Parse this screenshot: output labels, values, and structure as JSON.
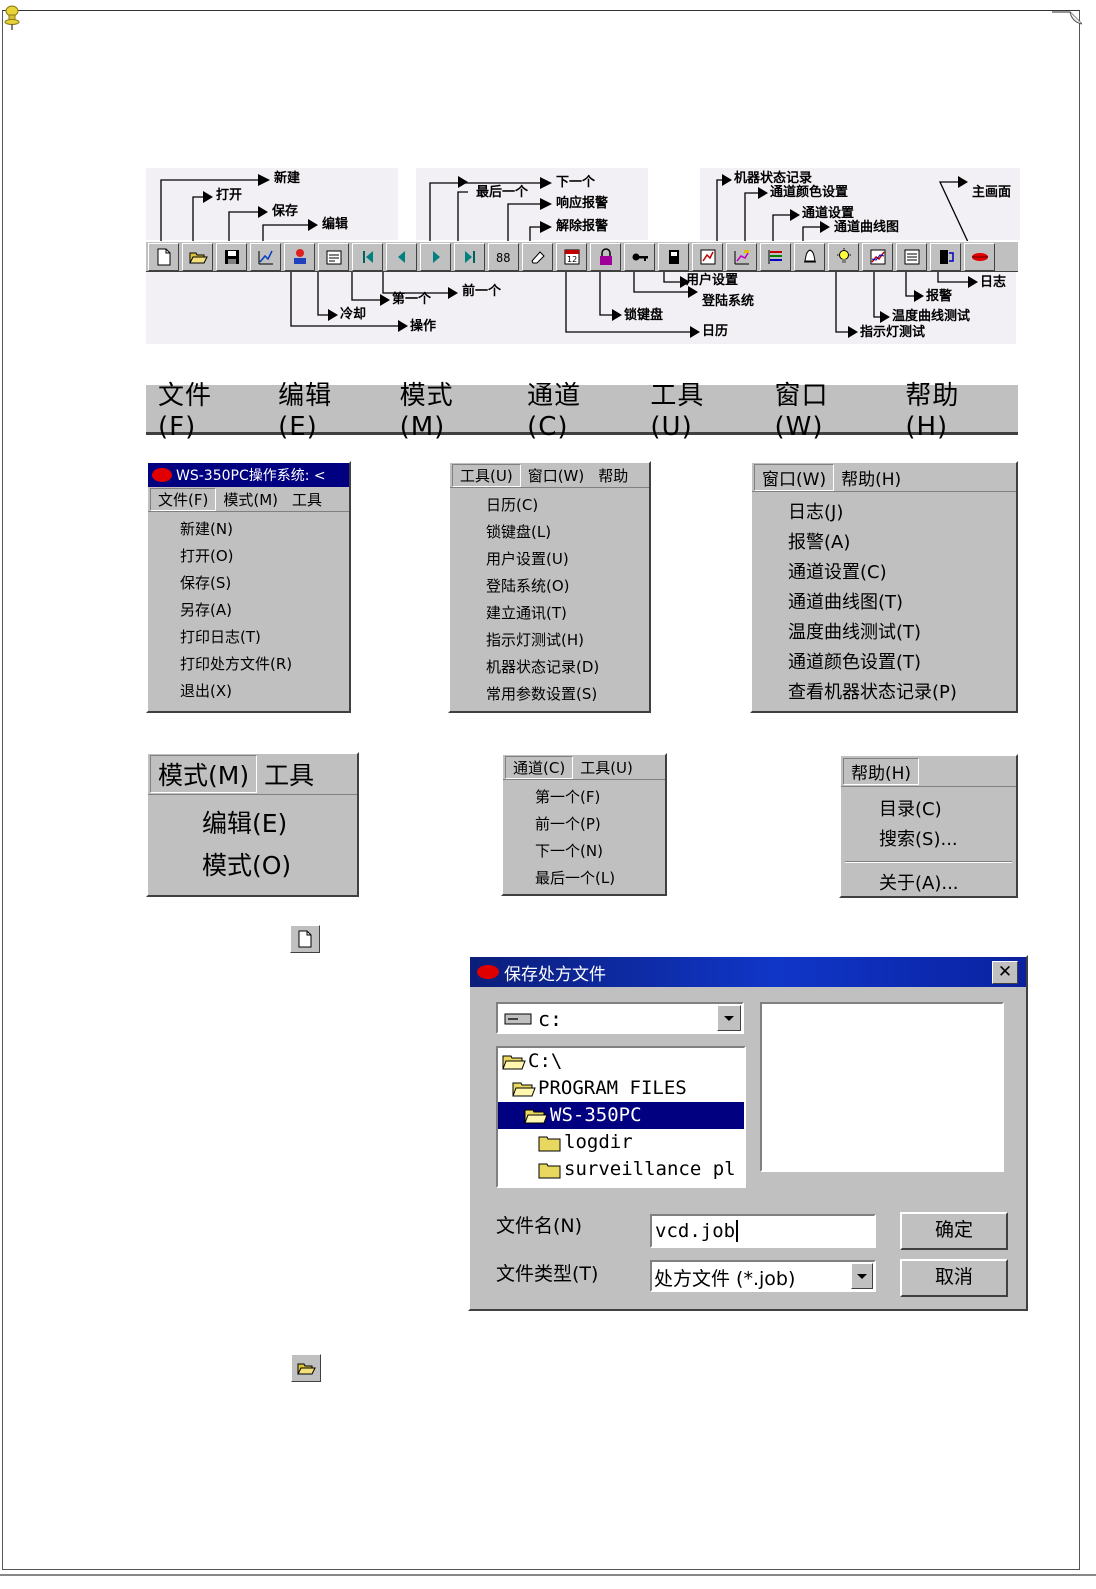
{
  "toolbar_labels": {
    "new": "新建",
    "open": "打开",
    "save": "保存",
    "edit": "编辑",
    "last": "最后一个",
    "next": "下一个",
    "ack_alarm": "响应报警",
    "clear_alarm": "解除报警",
    "machine_log": "机器状态记录",
    "channel_color": "通道颜色设置",
    "channel_setup": "通道设置",
    "channel_curve": "通道曲线图",
    "main": "主画面",
    "cool": "冷却",
    "first": "第一个",
    "prev": "前一个",
    "operate": "操作",
    "user_setup": "用户设置",
    "login": "登陆系统",
    "keylock": "锁键盘",
    "calendar": "日历",
    "log": "日志",
    "alarm": "报警",
    "temp_curve": "温度曲线测试",
    "lamp_test": "指示灯测试"
  },
  "menubar": [
    "文件(F)",
    "编辑(E)",
    "模式(M)",
    "通道(C)",
    "工具(U)",
    "窗口(W)",
    "帮助(H)"
  ],
  "file_menu": {
    "title": "WS-350PC操作系统: <",
    "bar": [
      "文件(F)",
      "模式(M)",
      "工具"
    ],
    "items": [
      "新建(N)",
      "打开(O)",
      "保存(S)",
      "另存(A)",
      "打印日志(T)",
      "打印处方文件(R)",
      "退出(X)"
    ]
  },
  "tools_menu": {
    "bar": [
      "工具(U)",
      "窗口(W)",
      "帮助"
    ],
    "items": [
      "日历(C)",
      "锁键盘(L)",
      "用户设置(U)",
      "登陆系统(O)",
      "建立通讯(T)",
      "指示灯测试(H)",
      "机器状态记录(D)",
      "常用参数设置(S)"
    ]
  },
  "window_menu": {
    "bar": [
      "窗口(W)",
      "帮助(H)"
    ],
    "items": [
      "日志(J)",
      "报警(A)",
      "通道设置(C)",
      "通道曲线图(T)",
      "温度曲线测试(T)",
      "通道颜色设置(T)",
      "查看机器状态记录(P)"
    ]
  },
  "mode_menu": {
    "bar": [
      "模式(M)",
      "工具"
    ],
    "items": [
      "编辑(E)",
      "模式(O)"
    ]
  },
  "channel_menu": {
    "bar": [
      "通道(C)",
      "工具(U)"
    ],
    "items": [
      "第一个(F)",
      "前一个(P)",
      "下一个(N)",
      "最后一个(L)"
    ]
  },
  "help_menu": {
    "bar": [
      "帮助(H)"
    ],
    "items": [
      "目录(C)",
      "搜索(S)...",
      "关于(A)..."
    ]
  },
  "dialog": {
    "title": "保存处方文件",
    "drive": "c:",
    "folders": [
      "C:\\",
      "PROGRAM FILES",
      "WS-350PC",
      "logdir",
      "surveillance pl"
    ],
    "filename_label": "文件名(N)",
    "filetype_label": "文件类型(T)",
    "filename_value": "vcd.job",
    "filetype_value": "处方文件 (*.job)",
    "ok": "确定",
    "cancel": "取消"
  }
}
